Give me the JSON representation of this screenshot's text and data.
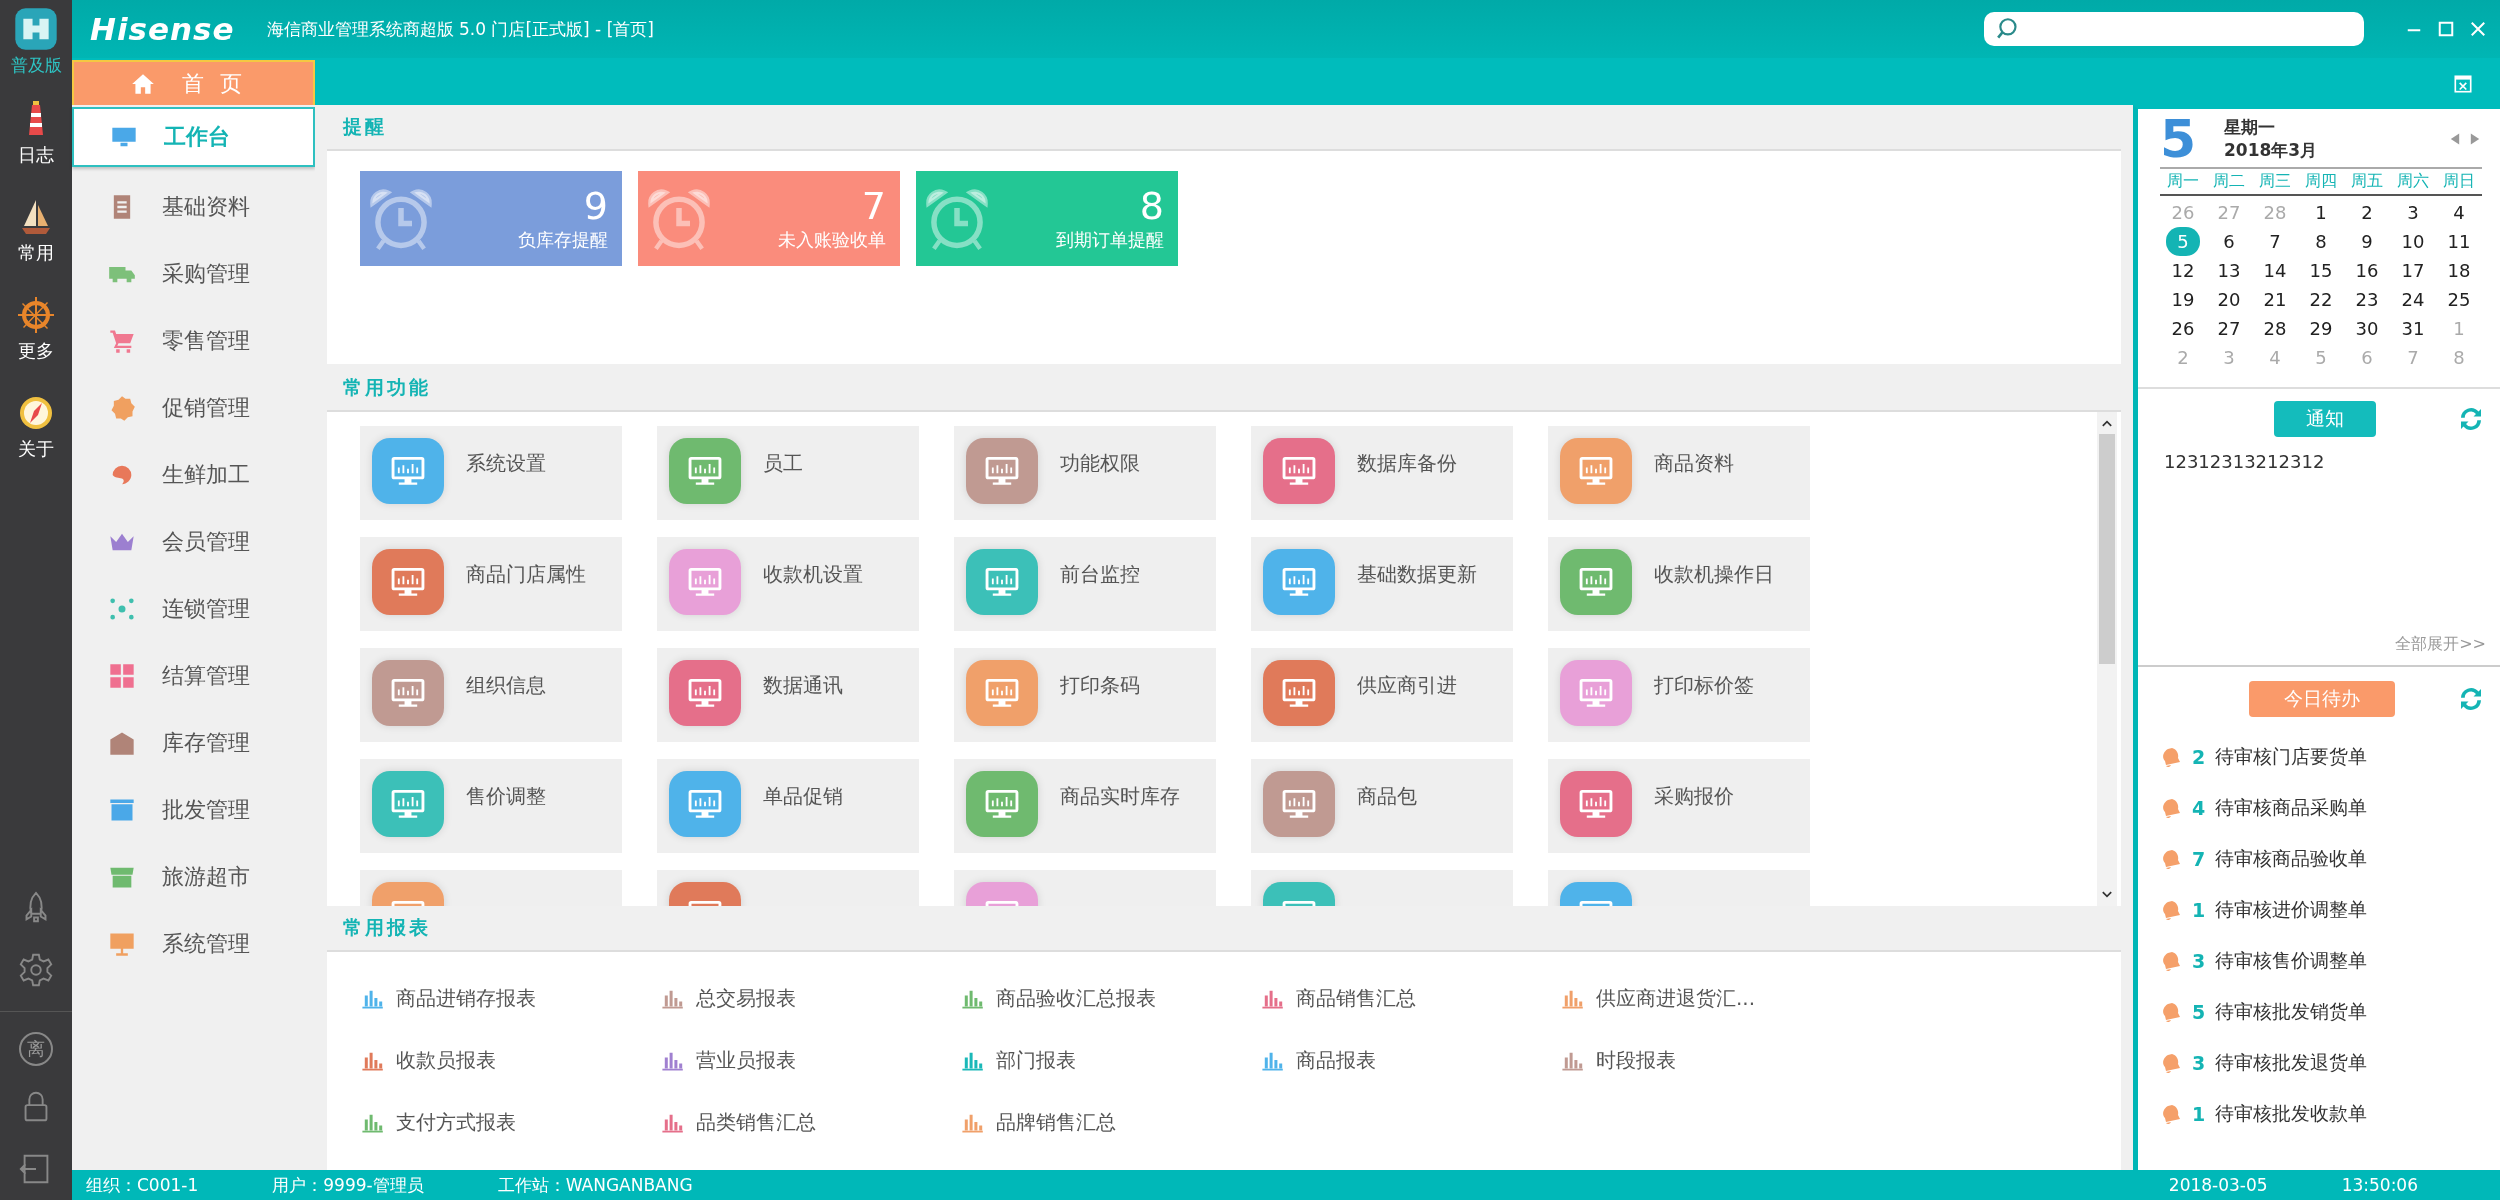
{
  "sidebar": {
    "edition": "普及版",
    "items": [
      {
        "label": "日志"
      },
      {
        "label": "常用"
      },
      {
        "label": "更多"
      },
      {
        "label": "关于"
      }
    ],
    "away_label": "离"
  },
  "window": {
    "logo": "Hisense",
    "title": "海信商业管理系统商超版 5.0 门店[正式版] - [首页]"
  },
  "tabs": [
    {
      "label": "首页",
      "selected": true
    }
  ],
  "nav": [
    {
      "label": "工作台",
      "selected": true
    },
    {
      "label": "基础资料",
      "selected": false
    },
    {
      "label": "采购管理",
      "selected": false
    },
    {
      "label": "零售管理",
      "selected": false
    },
    {
      "label": "促销管理",
      "selected": false
    },
    {
      "label": "生鲜加工",
      "selected": false
    },
    {
      "label": "会员管理",
      "selected": false
    },
    {
      "label": "连锁管理",
      "selected": false
    },
    {
      "label": "结算管理",
      "selected": false
    },
    {
      "label": "库存管理",
      "selected": false
    },
    {
      "label": "批发管理",
      "selected": false
    },
    {
      "label": "旅游超市",
      "selected": false
    },
    {
      "label": "系统管理",
      "selected": false
    }
  ],
  "reminders": {
    "title": "提醒",
    "items": [
      {
        "count": "9",
        "label": "负库存提醒",
        "color": "#7b9ddb"
      },
      {
        "count": "7",
        "label": "未入账验收单",
        "color": "#fa8c7c"
      },
      {
        "count": "8",
        "label": "到期订单提醒",
        "color": "#23c795"
      }
    ]
  },
  "functions": {
    "title": "常用功能",
    "items": [
      {
        "label": "系统设置",
        "color": "#4fb3ea"
      },
      {
        "label": "员工",
        "color": "#6fba6f"
      },
      {
        "label": "功能权限",
        "color": "#c09a92"
      },
      {
        "label": "数据库备份",
        "color": "#e56f8a"
      },
      {
        "label": "商品资料",
        "color": "#f0a06a"
      },
      {
        "label": "商品门店属性",
        "color": "#e07a5a"
      },
      {
        "label": "收款机设置",
        "color": "#e8a0d8"
      },
      {
        "label": "前台监控",
        "color": "#3cc0b8"
      },
      {
        "label": "基础数据更新",
        "color": "#4fb3ea"
      },
      {
        "label": "收款机操作日",
        "color": "#6fba6f"
      },
      {
        "label": "组织信息",
        "color": "#c09a92"
      },
      {
        "label": "数据通讯",
        "color": "#e56f8a"
      },
      {
        "label": "打印条码",
        "color": "#f0a06a"
      },
      {
        "label": "供应商引进",
        "color": "#e07a5a"
      },
      {
        "label": "打印标价签",
        "color": "#e8a0d8"
      },
      {
        "label": "售价调整",
        "color": "#3cc0b8"
      },
      {
        "label": "单品促销",
        "color": "#4fb3ea"
      },
      {
        "label": "商品实时库存",
        "color": "#6fba6f"
      },
      {
        "label": "商品包",
        "color": "#c09a92"
      },
      {
        "label": "采购报价",
        "color": "#e56f8a"
      },
      {
        "color": "#f0a06a"
      },
      {
        "color": "#e07a5a"
      },
      {
        "color": "#e8a0d8"
      },
      {
        "color": "#3cc0b8"
      },
      {
        "color": "#4fb3ea"
      }
    ]
  },
  "reports": {
    "title": "常用报表",
    "items": [
      {
        "label": "商品进销存报表",
        "color": "#4fb3ea"
      },
      {
        "label": "总交易报表",
        "color": "#c09a92"
      },
      {
        "label": "商品验收汇总报表",
        "color": "#6fba6f"
      },
      {
        "label": "商品销售汇总",
        "color": "#e56f8a"
      },
      {
        "label": "供应商进退货汇...",
        "color": "#f0a06a"
      },
      {
        "label": "收款员报表",
        "color": "#e07a5a"
      },
      {
        "label": "营业员报表",
        "color": "#a080d0"
      },
      {
        "label": "部门报表",
        "color": "#1ab8b8"
      },
      {
        "label": "商品报表",
        "color": "#4fb3ea"
      },
      {
        "label": "时段报表",
        "color": "#c09a92"
      },
      {
        "label": "支付方式报表",
        "color": "#6fba6f"
      },
      {
        "label": "品类销售汇总",
        "color": "#e56f8a"
      },
      {
        "label": "品牌销售汇总",
        "color": "#f0a06a"
      }
    ]
  },
  "calendar": {
    "day": "5",
    "weekday": "星期一",
    "month": "2018年3月",
    "weekdays": [
      "周一",
      "周二",
      "周三",
      "周四",
      "周五",
      "周六",
      "周日"
    ],
    "days": [
      {
        "label": "26",
        "other_month": true,
        "selected": false
      },
      {
        "label": "27",
        "other_month": true,
        "selected": false
      },
      {
        "label": "28",
        "other_month": true,
        "selected": false
      },
      {
        "label": "1",
        "other_month": false,
        "selected": false
      },
      {
        "label": "2",
        "other_month": false,
        "selected": false
      },
      {
        "label": "3",
        "other_month": false,
        "selected": false
      },
      {
        "label": "4",
        "other_month": false,
        "selected": false
      },
      {
        "label": "5",
        "other_month": false,
        "selected": true
      },
      {
        "label": "6",
        "other_month": false,
        "selected": false
      },
      {
        "label": "7",
        "other_month": false,
        "selected": false
      },
      {
        "label": "8",
        "other_month": false,
        "selected": false
      },
      {
        "label": "9",
        "other_month": false,
        "selected": false
      },
      {
        "label": "10",
        "other_month": false,
        "selected": false
      },
      {
        "label": "11",
        "other_month": false,
        "selected": false
      },
      {
        "label": "12",
        "other_month": false,
        "selected": false
      },
      {
        "label": "13",
        "other_month": false,
        "selected": false
      },
      {
        "label": "14",
        "other_month": false,
        "selected": false
      },
      {
        "label": "15",
        "other_month": false,
        "selected": false
      },
      {
        "label": "16",
        "other_month": false,
        "selected": false
      },
      {
        "label": "17",
        "other_month": false,
        "selected": false
      },
      {
        "label": "18",
        "other_month": false,
        "selected": false
      },
      {
        "label": "19",
        "other_month": false,
        "selected": false
      },
      {
        "label": "20",
        "other_month": false,
        "selected": false
      },
      {
        "label": "21",
        "other_month": false,
        "selected": false
      },
      {
        "label": "22",
        "other_month": false,
        "selected": false
      },
      {
        "label": "23",
        "other_month": false,
        "selected": false
      },
      {
        "label": "24",
        "other_month": false,
        "selected": false
      },
      {
        "label": "25",
        "other_month": false,
        "selected": false
      },
      {
        "label": "26",
        "other_month": false,
        "selected": false
      },
      {
        "label": "27",
        "other_month": false,
        "selected": false
      },
      {
        "label": "28",
        "other_month": false,
        "selected": false
      },
      {
        "label": "29",
        "other_month": false,
        "selected": false
      },
      {
        "label": "30",
        "other_month": false,
        "selected": false
      },
      {
        "label": "31",
        "other_month": false,
        "selected": false
      },
      {
        "label": "1",
        "other_month": true,
        "selected": false
      },
      {
        "label": "2",
        "other_month": true,
        "selected": false
      },
      {
        "label": "3",
        "other_month": true,
        "selected": false
      },
      {
        "label": "4",
        "other_month": true,
        "selected": false
      },
      {
        "label": "5",
        "other_month": true,
        "selected": false
      },
      {
        "label": "6",
        "other_month": true,
        "selected": false
      },
      {
        "label": "7",
        "other_month": true,
        "selected": false
      },
      {
        "label": "8",
        "other_month": true,
        "selected": false
      }
    ]
  },
  "notice": {
    "button": "通知",
    "text": "12312313212312",
    "expand_link": "全部展开>>"
  },
  "todo": {
    "button": "今日待办",
    "items": [
      {
        "count": "2",
        "label": "待审核门店要货单"
      },
      {
        "count": "4",
        "label": "待审核商品采购单"
      },
      {
        "count": "7",
        "label": "待审核商品验收单"
      },
      {
        "count": "1",
        "label": "待审核进价调整单"
      },
      {
        "count": "3",
        "label": "待审核售价调整单"
      },
      {
        "count": "5",
        "label": "待审核批发销货单"
      },
      {
        "count": "3",
        "label": "待审核批发退货单"
      },
      {
        "count": "1",
        "label": "待审核批发收款单"
      }
    ]
  },
  "status_bar": {
    "org": "组织：C001-1",
    "user": "用户：9999-管理员",
    "workstation": "工作站：WANGANBANG",
    "date": "2018-03-05",
    "time": "13:50:06"
  }
}
